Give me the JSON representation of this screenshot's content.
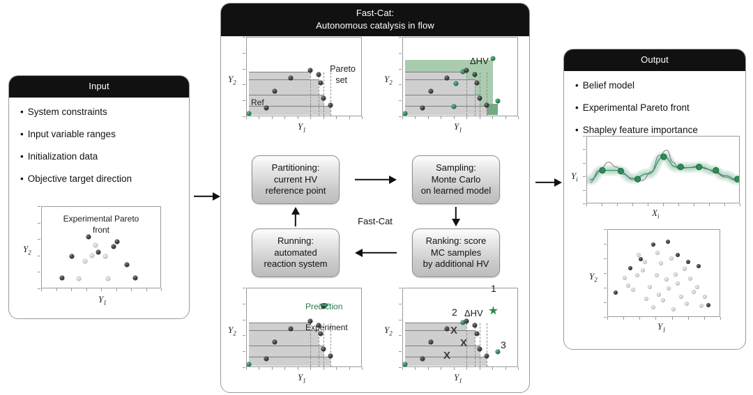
{
  "input_panel": {
    "title": "Input",
    "bullets": [
      "System constraints",
      "Input variable ranges",
      "Initialization data",
      "Objective target direction"
    ],
    "chart": {
      "title_line1": "Experimental Pareto",
      "title_line2": "front",
      "xlabel": "Y",
      "xlabel_sub": "1",
      "ylabel": "Y",
      "ylabel_sub": "2"
    }
  },
  "center_panel": {
    "title_line1": "Fast-Cat:",
    "title_line2": "Autonomous catalysis in flow",
    "cycle_label": "Fast-Cat",
    "boxes": [
      {
        "id": "partitioning",
        "lines": [
          "Partitioning:",
          "current HV",
          "reference point"
        ]
      },
      {
        "id": "sampling",
        "lines": [
          "Sampling:",
          "Monte Carlo",
          "on learned model"
        ]
      },
      {
        "id": "ranking",
        "lines": [
          "Ranking: score",
          "MC samples",
          "by additional HV"
        ]
      },
      {
        "id": "running",
        "lines": [
          "Running:",
          "automated",
          "reaction system"
        ]
      }
    ],
    "chart_pareto": {
      "ref_label": "Ref",
      "pareto_line1": "Pareto",
      "pareto_line2": "set",
      "xlabel": "Y",
      "xlabel_sub": "1",
      "ylabel": "Y",
      "ylabel_sub": "2"
    },
    "chart_dhv": {
      "dhv_label": "ΔHV",
      "xlabel": "Y",
      "xlabel_sub": "1",
      "ylabel": "Y",
      "ylabel_sub": "2"
    },
    "chart_prediction": {
      "prediction_label": "Prediction",
      "experiment_label": "Experiment",
      "xlabel": "Y",
      "xlabel_sub": "1",
      "ylabel": "Y",
      "ylabel_sub": "2"
    },
    "chart_ranking": {
      "dhv_label": "ΔHV",
      "rank_labels": [
        "1",
        "2",
        "3"
      ],
      "reject_marks": [
        "X",
        "X",
        "X"
      ],
      "xlabel": "Y",
      "xlabel_sub": "1",
      "ylabel": "Y",
      "ylabel_sub": "2"
    }
  },
  "output_panel": {
    "title": "Output",
    "bullets": [
      "Belief model",
      "Experimental Pareto front",
      "Shapley feature importance"
    ],
    "chart_belief": {
      "xlabel": "X",
      "xlabel_sub": "i",
      "ylabel": "Y",
      "ylabel_sub": "i"
    },
    "chart_scatter": {
      "xlabel": "Y",
      "xlabel_sub": "1",
      "ylabel": "Y",
      "ylabel_sub": "2"
    }
  },
  "colors": {
    "header_bg": "#111111",
    "green_light": "#a9ccae",
    "green_dark": "#74a983",
    "green_accent": "#2e8b57",
    "hv_grey": "#cfcfcf",
    "border": "#9a9a9a"
  },
  "chart_data": {
    "input_pareto_scatter": {
      "type": "scatter",
      "title": "Experimental Pareto front",
      "xlabel": "Y1",
      "ylabel": "Y2",
      "xlim": [
        0,
        100
      ],
      "ylim": [
        0,
        100
      ],
      "grid": false,
      "series": [
        {
          "name": "pareto-front",
          "color": "#1b1b1b",
          "points": [
            [
              17,
              12
            ],
            [
              25,
              38
            ],
            [
              39,
              62
            ],
            [
              47,
              43
            ],
            [
              60,
              50
            ],
            [
              63,
              56
            ],
            [
              71,
              28
            ],
            [
              78,
              12
            ]
          ]
        },
        {
          "name": "dominated",
          "color": "#c8c8c8",
          "points": [
            [
              31,
              11
            ],
            [
              36,
              32
            ],
            [
              42,
              39
            ],
            [
              45,
              52
            ],
            [
              53,
              38
            ],
            [
              55,
              11
            ]
          ]
        }
      ]
    },
    "center_pareto_set": {
      "type": "scatter",
      "annotations": [
        "Ref",
        "Pareto set"
      ],
      "xlabel": "Y1",
      "ylabel": "Y2",
      "xlim": [
        0,
        100
      ],
      "ylim": [
        0,
        100
      ],
      "reference_point": [
        2,
        3
      ],
      "hv_step_blocks": [
        {
          "x": [
            2,
            55
          ],
          "y": [
            3,
            57
          ]
        },
        {
          "x": [
            2,
            62
          ],
          "y": [
            3,
            47
          ]
        },
        {
          "x": [
            2,
            66
          ],
          "y": [
            3,
            28
          ]
        },
        {
          "x": [
            2,
            72
          ],
          "y": [
            3,
            14
          ]
        }
      ],
      "series": [
        {
          "name": "pareto-points",
          "color": "#1b1b1b",
          "points": [
            [
              55,
              57
            ],
            [
              38,
              47
            ],
            [
              62,
              52
            ],
            [
              24,
              31
            ],
            [
              64,
              41
            ],
            [
              66,
              22
            ],
            [
              72,
              13
            ],
            [
              17,
              10
            ]
          ]
        }
      ]
    },
    "center_dhv": {
      "type": "scatter",
      "annotations": [
        "ΔHV"
      ],
      "xlabel": "Y1",
      "ylabel": "Y2",
      "xlim": [
        0,
        100
      ],
      "ylim": [
        0,
        100
      ],
      "reference_point": [
        2,
        3
      ],
      "delta_hv_regions": [
        {
          "x": [
            2,
            78
          ],
          "y": [
            57,
            72
          ],
          "shade": "light"
        },
        {
          "x": [
            2,
            52
          ],
          "y": [
            50,
            57
          ],
          "shade": "dark"
        },
        {
          "x": [
            55,
            78
          ],
          "y": [
            3,
            57
          ],
          "shade": "light"
        },
        {
          "x": [
            72,
            82
          ],
          "y": [
            3,
            17
          ],
          "shade": "dark"
        }
      ],
      "series": [
        {
          "name": "new-points",
          "color": "#2e8b57",
          "points": [
            [
              78,
              72
            ],
            [
              52,
              55
            ],
            [
              46,
              40
            ],
            [
              82,
              18
            ],
            [
              44,
              11
            ]
          ]
        },
        {
          "name": "existing-points",
          "color": "#1b1b1b",
          "points": [
            [
              55,
              57
            ],
            [
              38,
              47
            ],
            [
              62,
              52
            ],
            [
              24,
              31
            ],
            [
              64,
              41
            ],
            [
              66,
              22
            ],
            [
              72,
              13
            ],
            [
              17,
              10
            ]
          ]
        }
      ]
    },
    "center_prediction": {
      "type": "scatter",
      "annotations": [
        "Prediction",
        "Experiment"
      ],
      "xlabel": "Y1",
      "ylabel": "Y2",
      "xlim": [
        0,
        100
      ],
      "ylim": [
        0,
        100
      ],
      "reference_point": [
        2,
        3
      ],
      "predicted_point": [
        66,
        76
      ],
      "experiment_point": [
        66,
        76
      ],
      "series": [
        {
          "name": "existing-points",
          "color": "#1b1b1b",
          "points": [
            [
              55,
              57
            ],
            [
              38,
              47
            ],
            [
              62,
              52
            ],
            [
              24,
              31
            ],
            [
              64,
              41
            ],
            [
              66,
              22
            ],
            [
              72,
              13
            ],
            [
              17,
              10
            ]
          ]
        }
      ]
    },
    "center_ranking": {
      "type": "scatter",
      "annotations": [
        "ΔHV",
        "1",
        "2",
        "3",
        "X",
        "X",
        "X"
      ],
      "xlabel": "Y1",
      "ylabel": "Y2",
      "xlim": [
        0,
        100
      ],
      "ylim": [
        0,
        100
      ],
      "reference_point": [
        2,
        3
      ],
      "ranked_candidates": [
        {
          "rank": 1,
          "point": [
            78,
            72
          ],
          "marker": "star"
        },
        {
          "rank": 2,
          "point": [
            52,
            55
          ],
          "marker": "dot"
        },
        {
          "rank": 3,
          "point": [
            82,
            18
          ],
          "marker": "dot"
        }
      ],
      "rejected": [
        [
          44,
          40
        ],
        [
          52,
          27
        ],
        [
          34,
          12
        ]
      ],
      "series": [
        {
          "name": "existing-points",
          "color": "#1b1b1b",
          "points": [
            [
              55,
              57
            ],
            [
              38,
              47
            ],
            [
              62,
              52
            ],
            [
              24,
              31
            ],
            [
              64,
              41
            ],
            [
              66,
              22
            ],
            [
              72,
              13
            ],
            [
              17,
              10
            ]
          ]
        }
      ]
    },
    "output_belief": {
      "type": "line",
      "xlabel": "Xi",
      "ylabel": "Yi",
      "xlim": [
        0,
        100
      ],
      "ylim": [
        0,
        100
      ],
      "grid": false,
      "series": [
        {
          "name": "true-function",
          "color": "#6b6b6b",
          "style": "solid",
          "x": [
            2,
            8,
            14,
            19,
            24,
            30,
            36,
            42,
            47,
            52,
            56,
            60,
            66,
            72,
            78,
            84,
            90,
            96
          ],
          "y": [
            32,
            50,
            62,
            55,
            44,
            36,
            35,
            48,
            72,
            80,
            62,
            52,
            54,
            56,
            52,
            46,
            40,
            36
          ]
        },
        {
          "name": "belief-mean",
          "color": "#2e8b57",
          "style": "solid",
          "x": [
            2,
            10,
            20,
            30,
            40,
            50,
            58,
            66,
            74,
            82,
            90,
            98
          ],
          "y": [
            36,
            50,
            50,
            38,
            45,
            70,
            55,
            54,
            55,
            50,
            42,
            36
          ]
        }
      ],
      "observations": [
        [
          10,
          50
        ],
        [
          22,
          49
        ],
        [
          33,
          37
        ],
        [
          50,
          70
        ],
        [
          61,
          55
        ],
        [
          73,
          55
        ],
        [
          84,
          50
        ],
        [
          98,
          37
        ]
      ],
      "uncertainty_band": true
    },
    "output_scatter": {
      "type": "scatter",
      "xlabel": "Y1",
      "ylabel": "Y2",
      "xlim": [
        0,
        100
      ],
      "ylim": [
        0,
        100
      ],
      "series": [
        {
          "name": "pareto-front",
          "color": "#1b1b1b",
          "points": [
            [
              7,
              27
            ],
            [
              20,
              55
            ],
            [
              29,
              65
            ],
            [
              40,
              82
            ],
            [
              53,
              85
            ],
            [
              62,
              70
            ],
            [
              71,
              62
            ],
            [
              80,
              57
            ],
            [
              89,
              13
            ]
          ]
        },
        {
          "name": "dominated",
          "color": "#c8c8c8",
          "points": [
            [
              15,
              44
            ],
            [
              18,
              35
            ],
            [
              22,
              30
            ],
            [
              26,
              47
            ],
            [
              27,
              70
            ],
            [
              31,
              52
            ],
            [
              33,
              62
            ],
            [
              34,
              20
            ],
            [
              37,
              33
            ],
            [
              40,
              10
            ],
            [
              43,
              47
            ],
            [
              44,
              72
            ],
            [
              45,
              25
            ],
            [
              47,
              60
            ],
            [
              49,
              18
            ],
            [
              52,
              42
            ],
            [
              54,
              32
            ],
            [
              56,
              66
            ],
            [
              58,
              8
            ],
            [
              60,
              48
            ],
            [
              62,
              37
            ],
            [
              65,
              22
            ],
            [
              68,
              54
            ],
            [
              70,
              14
            ],
            [
              73,
              43
            ],
            [
              76,
              28
            ],
            [
              79,
              33
            ],
            [
              83,
              12
            ],
            [
              86,
              22
            ]
          ]
        }
      ]
    }
  }
}
